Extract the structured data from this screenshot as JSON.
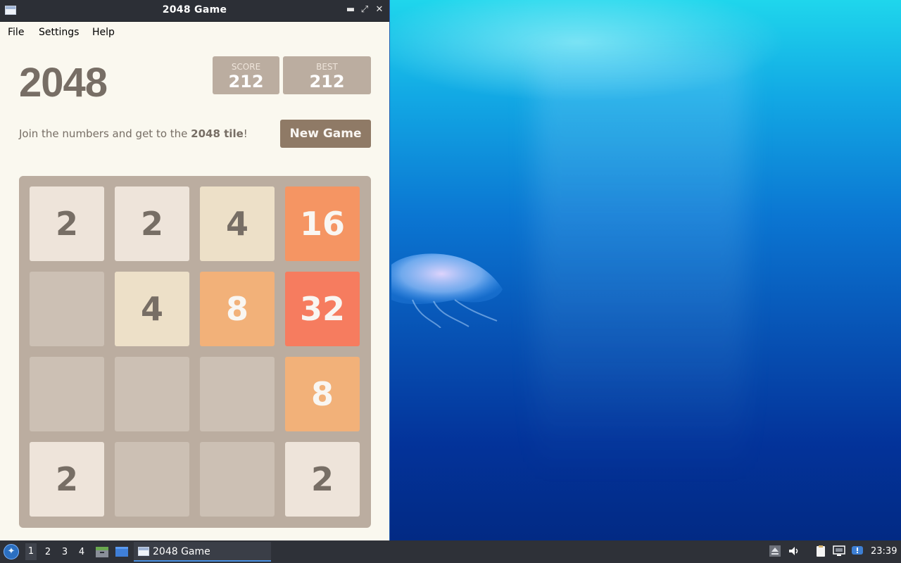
{
  "window": {
    "title": "2048 Game",
    "controls": {
      "minimize": "▬",
      "maximize": "⤢",
      "close": "✕"
    }
  },
  "menu": [
    "File",
    "Settings",
    "Help"
  ],
  "game": {
    "title": "2048",
    "score_label": "SCORE",
    "score_value": "212",
    "best_label": "BEST",
    "best_value": "212",
    "intro_prefix": "Join the numbers and get to the ",
    "intro_bold": "2048 tile",
    "intro_suffix": "!",
    "new_game_label": "New Game",
    "grid": [
      [
        2,
        2,
        4,
        16
      ],
      [
        0,
        4,
        8,
        32
      ],
      [
        0,
        0,
        0,
        8
      ],
      [
        2,
        0,
        0,
        2
      ]
    ],
    "tile_colors": {
      "2": {
        "bg": "#eee4da",
        "fg": "#776e65"
      },
      "4": {
        "bg": "#ede0c8",
        "fg": "#776e65"
      },
      "8": {
        "bg": "#f2b179",
        "fg": "#f9f6f2"
      },
      "16": {
        "bg": "#f59563",
        "fg": "#f9f6f2"
      },
      "32": {
        "bg": "#f67c5f",
        "fg": "#f9f6f2"
      }
    }
  },
  "taskbar": {
    "workspaces": [
      "1",
      "2",
      "3",
      "4"
    ],
    "active_workspace": "1",
    "task_label": "2048 Game",
    "clock": "23:39"
  }
}
